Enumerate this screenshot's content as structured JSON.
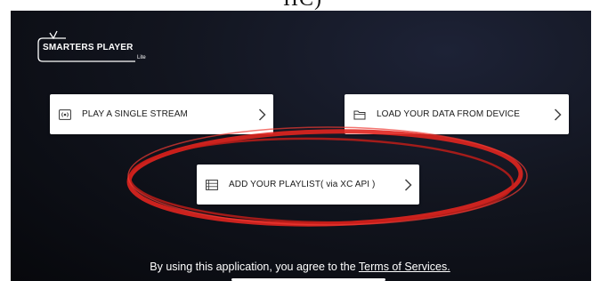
{
  "top_caption": "IIC)",
  "logo": {
    "title": "SMARTERS PLAYER",
    "subtitle": "Lite"
  },
  "cards": {
    "single_stream": {
      "label": "PLAY A SINGLE STREAM",
      "icon": "stream-icon"
    },
    "load_device": {
      "label": "LOAD YOUR DATA FROM DEVICE",
      "icon": "folder-icon"
    },
    "playlist": {
      "label": "ADD YOUR PLAYLIST( via XC API )",
      "icon": "playlist-icon"
    }
  },
  "footer": {
    "text": "By using this application, you agree to the ",
    "link": "Terms of Services."
  },
  "colors": {
    "background": "#0b0d14",
    "card": "#ffffff",
    "annotation": "#e0251f"
  }
}
